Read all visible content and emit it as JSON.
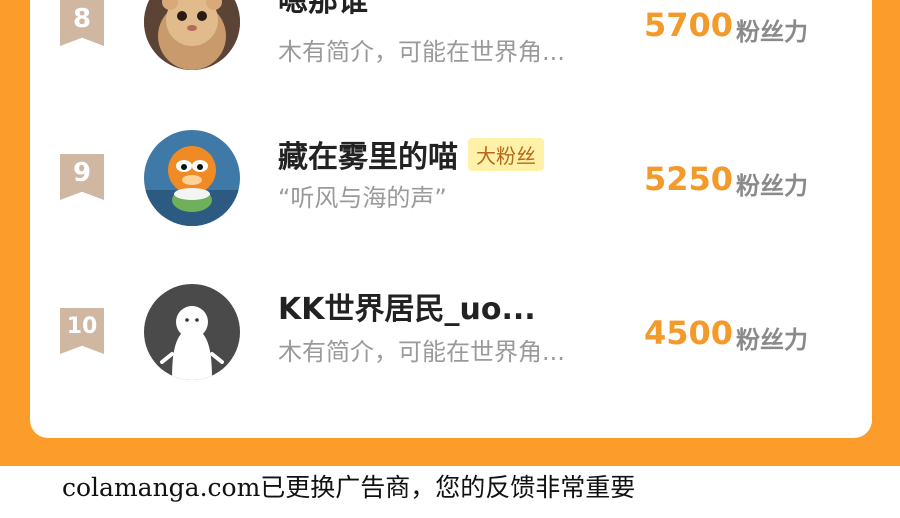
{
  "colors": {
    "background_orange": "#fb9c2b",
    "score_orange": "#f39a2a",
    "rank_badge": "#cfb7a2",
    "fan_badge_bg": "#fff1a8"
  },
  "ranking": [
    {
      "rank": "8",
      "avatar_icon": "hamster-avatar",
      "name": "嗯那谁",
      "badge": "",
      "bio": "木有简介，可能在世界角...",
      "score": "5700",
      "score_unit": "粉丝力"
    },
    {
      "rank": "9",
      "avatar_icon": "garfield-avatar",
      "name": "藏在雾里的喵",
      "badge": "大粉丝",
      "bio": "“听风与海的声”",
      "score": "5250",
      "score_unit": "粉丝力"
    },
    {
      "rank": "10",
      "avatar_icon": "default-ghost-avatar",
      "name": "KK世界居民_uo...",
      "badge": "",
      "bio": "木有简介，可能在世界角...",
      "score": "4500",
      "score_unit": "粉丝力"
    }
  ],
  "footer": {
    "notice": "colamanga.com已更换广告商，您的反馈非常重要"
  }
}
